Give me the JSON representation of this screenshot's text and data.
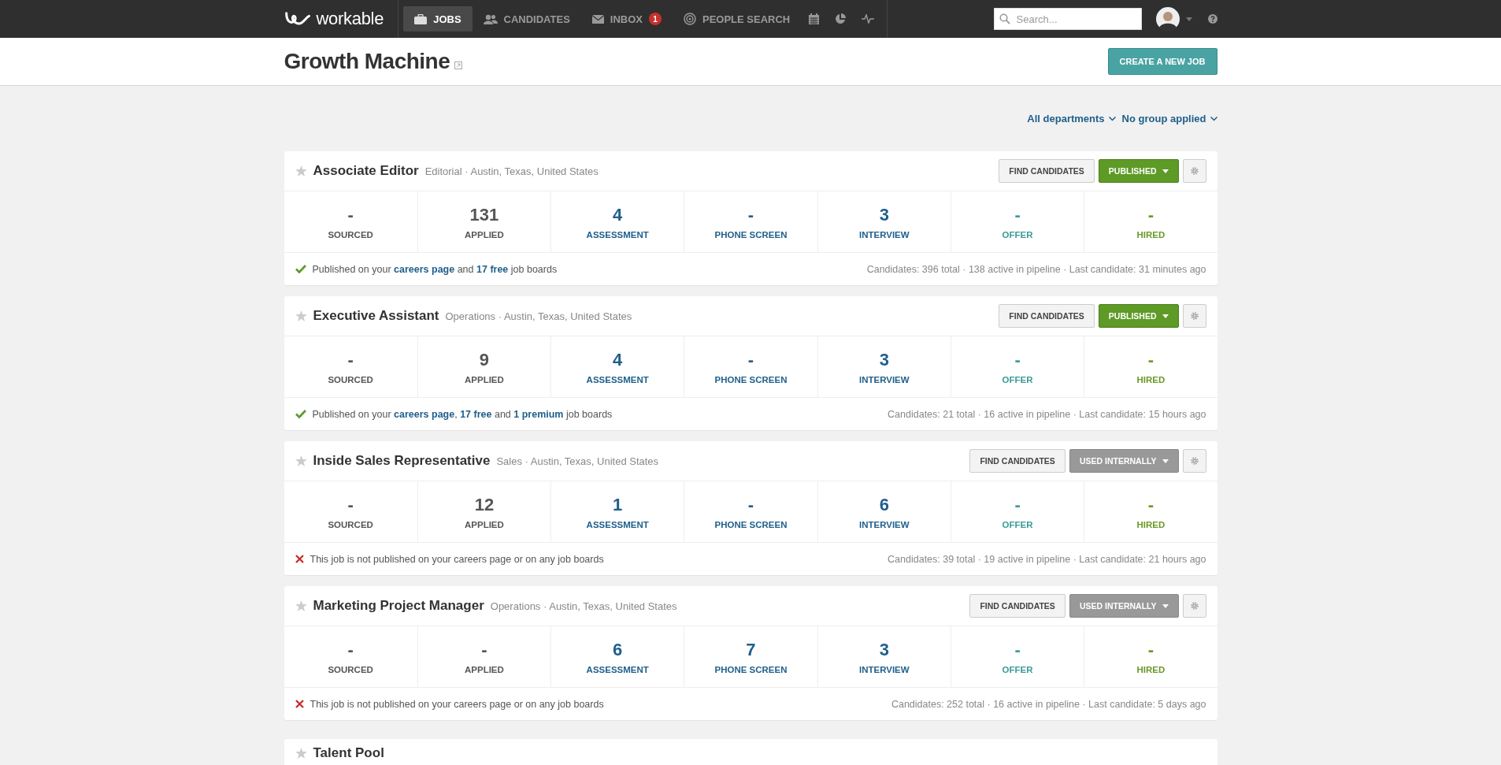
{
  "nav": {
    "logo": "workable",
    "items": [
      {
        "kind": "jobs",
        "label": "JOBS",
        "selected": true
      },
      {
        "kind": "candidates",
        "label": "CANDIDATES",
        "selected": false
      },
      {
        "kind": "inbox",
        "label": "INBOX",
        "badge": "1",
        "selected": false
      },
      {
        "kind": "people",
        "label": "PEOPLE SEARCH",
        "selected": false
      },
      {
        "kind": "calendar",
        "selected": false
      },
      {
        "kind": "reports",
        "selected": false
      },
      {
        "kind": "activity",
        "selected": false
      }
    ],
    "search": {
      "placeholder": "Search..."
    }
  },
  "header": {
    "title": "Growth Machine",
    "button": "CREATE A NEW JOB"
  },
  "filters": [
    "All departments",
    "No group applied"
  ],
  "jobs": [
    {
      "title": "Associate Editor",
      "meta": "Editorial · Austin, Texas, United States",
      "starred": false,
      "find": "FIND CANDIDATES",
      "status": {
        "kind": "published",
        "label": "PUBLISHED"
      },
      "stages": [
        {
          "count": "-",
          "label": "SOURCED",
          "color": "#555555"
        },
        {
          "count": "131",
          "label": "APPLIED",
          "color": "#555555"
        },
        {
          "count": "4",
          "label": "ASSESSMENT",
          "color": "#1f5f8b"
        },
        {
          "count": "-",
          "label": "PHONE SCREEN",
          "color": "#1f5f8b"
        },
        {
          "count": "3",
          "label": "INTERVIEW",
          "color": "#1f5f8b"
        },
        {
          "count": "-",
          "label": "OFFER",
          "color": "#3a9a9a"
        },
        {
          "count": "-",
          "label": "HIRED",
          "color": "#6a9a2a"
        }
      ],
      "published": true,
      "note": [
        {
          "kind": "text",
          "text": "Published on your "
        },
        {
          "kind": "link",
          "text": "careers page"
        },
        {
          "kind": "text",
          "text": " and "
        },
        {
          "kind": "link",
          "text": "17 free"
        },
        {
          "kind": "text",
          "text": " job boards"
        }
      ],
      "summary": "Candidates: 396 total · 138 active in pipeline · Last candidate: 31 minutes ago"
    },
    {
      "title": "Executive Assistant",
      "meta": "Operations · Austin, Texas, United States",
      "starred": false,
      "find": "FIND CANDIDATES",
      "status": {
        "kind": "published",
        "label": "PUBLISHED"
      },
      "stages": [
        {
          "count": "-",
          "label": "SOURCED",
          "color": "#555555"
        },
        {
          "count": "9",
          "label": "APPLIED",
          "color": "#555555"
        },
        {
          "count": "4",
          "label": "ASSESSMENT",
          "color": "#1f5f8b"
        },
        {
          "count": "-",
          "label": "PHONE SCREEN",
          "color": "#1f5f8b"
        },
        {
          "count": "3",
          "label": "INTERVIEW",
          "color": "#1f5f8b"
        },
        {
          "count": "-",
          "label": "OFFER",
          "color": "#3a9a9a"
        },
        {
          "count": "-",
          "label": "HIRED",
          "color": "#6a9a2a"
        }
      ],
      "published": true,
      "note": [
        {
          "kind": "text",
          "text": "Published on your "
        },
        {
          "kind": "link",
          "text": "careers page"
        },
        {
          "kind": "text",
          "text": ", "
        },
        {
          "kind": "link",
          "text": "17 free"
        },
        {
          "kind": "text",
          "text": " and "
        },
        {
          "kind": "link",
          "text": "1 premium"
        },
        {
          "kind": "text",
          "text": " job boards"
        }
      ],
      "summary": "Candidates: 21 total · 16 active in pipeline · Last candidate: 15 hours ago"
    },
    {
      "title": "Inside Sales Representative",
      "meta": "Sales · Austin, Texas, United States",
      "starred": false,
      "find": "FIND CANDIDATES",
      "status": {
        "kind": "internal",
        "label": "USED INTERNALLY"
      },
      "stages": [
        {
          "count": "-",
          "label": "SOURCED",
          "color": "#555555"
        },
        {
          "count": "12",
          "label": "APPLIED",
          "color": "#555555"
        },
        {
          "count": "1",
          "label": "ASSESSMENT",
          "color": "#1f5f8b"
        },
        {
          "count": "-",
          "label": "PHONE SCREEN",
          "color": "#1f5f8b"
        },
        {
          "count": "6",
          "label": "INTERVIEW",
          "color": "#1f5f8b"
        },
        {
          "count": "-",
          "label": "OFFER",
          "color": "#3a9a9a"
        },
        {
          "count": "-",
          "label": "HIRED",
          "color": "#6a9a2a"
        }
      ],
      "published": false,
      "note": [
        {
          "kind": "text",
          "text": "This job is not published on your careers page or on any job boards"
        }
      ],
      "summary": "Candidates: 39 total · 19 active in pipeline · Last candidate: 21 hours ago"
    },
    {
      "title": "Marketing Project Manager",
      "meta": "Operations · Austin, Texas, United States",
      "starred": false,
      "find": "FIND CANDIDATES",
      "status": {
        "kind": "internal",
        "label": "USED INTERNALLY"
      },
      "stages": [
        {
          "count": "-",
          "label": "SOURCED",
          "color": "#555555"
        },
        {
          "count": "-",
          "label": "APPLIED",
          "color": "#555555"
        },
        {
          "count": "6",
          "label": "ASSESSMENT",
          "color": "#1f5f8b"
        },
        {
          "count": "7",
          "label": "PHONE SCREEN",
          "color": "#1f5f8b"
        },
        {
          "count": "3",
          "label": "INTERVIEW",
          "color": "#1f5f8b"
        },
        {
          "count": "-",
          "label": "OFFER",
          "color": "#3a9a9a"
        },
        {
          "count": "-",
          "label": "HIRED",
          "color": "#6a9a2a"
        }
      ],
      "published": false,
      "note": [
        {
          "kind": "text",
          "text": "This job is not published on your careers page or on any job boards"
        }
      ],
      "summary": "Candidates: 252 total · 16 active in pipeline · Last candidate: 5 days ago"
    }
  ],
  "talent_pool": {
    "title": "Talent Pool",
    "starred": false
  }
}
